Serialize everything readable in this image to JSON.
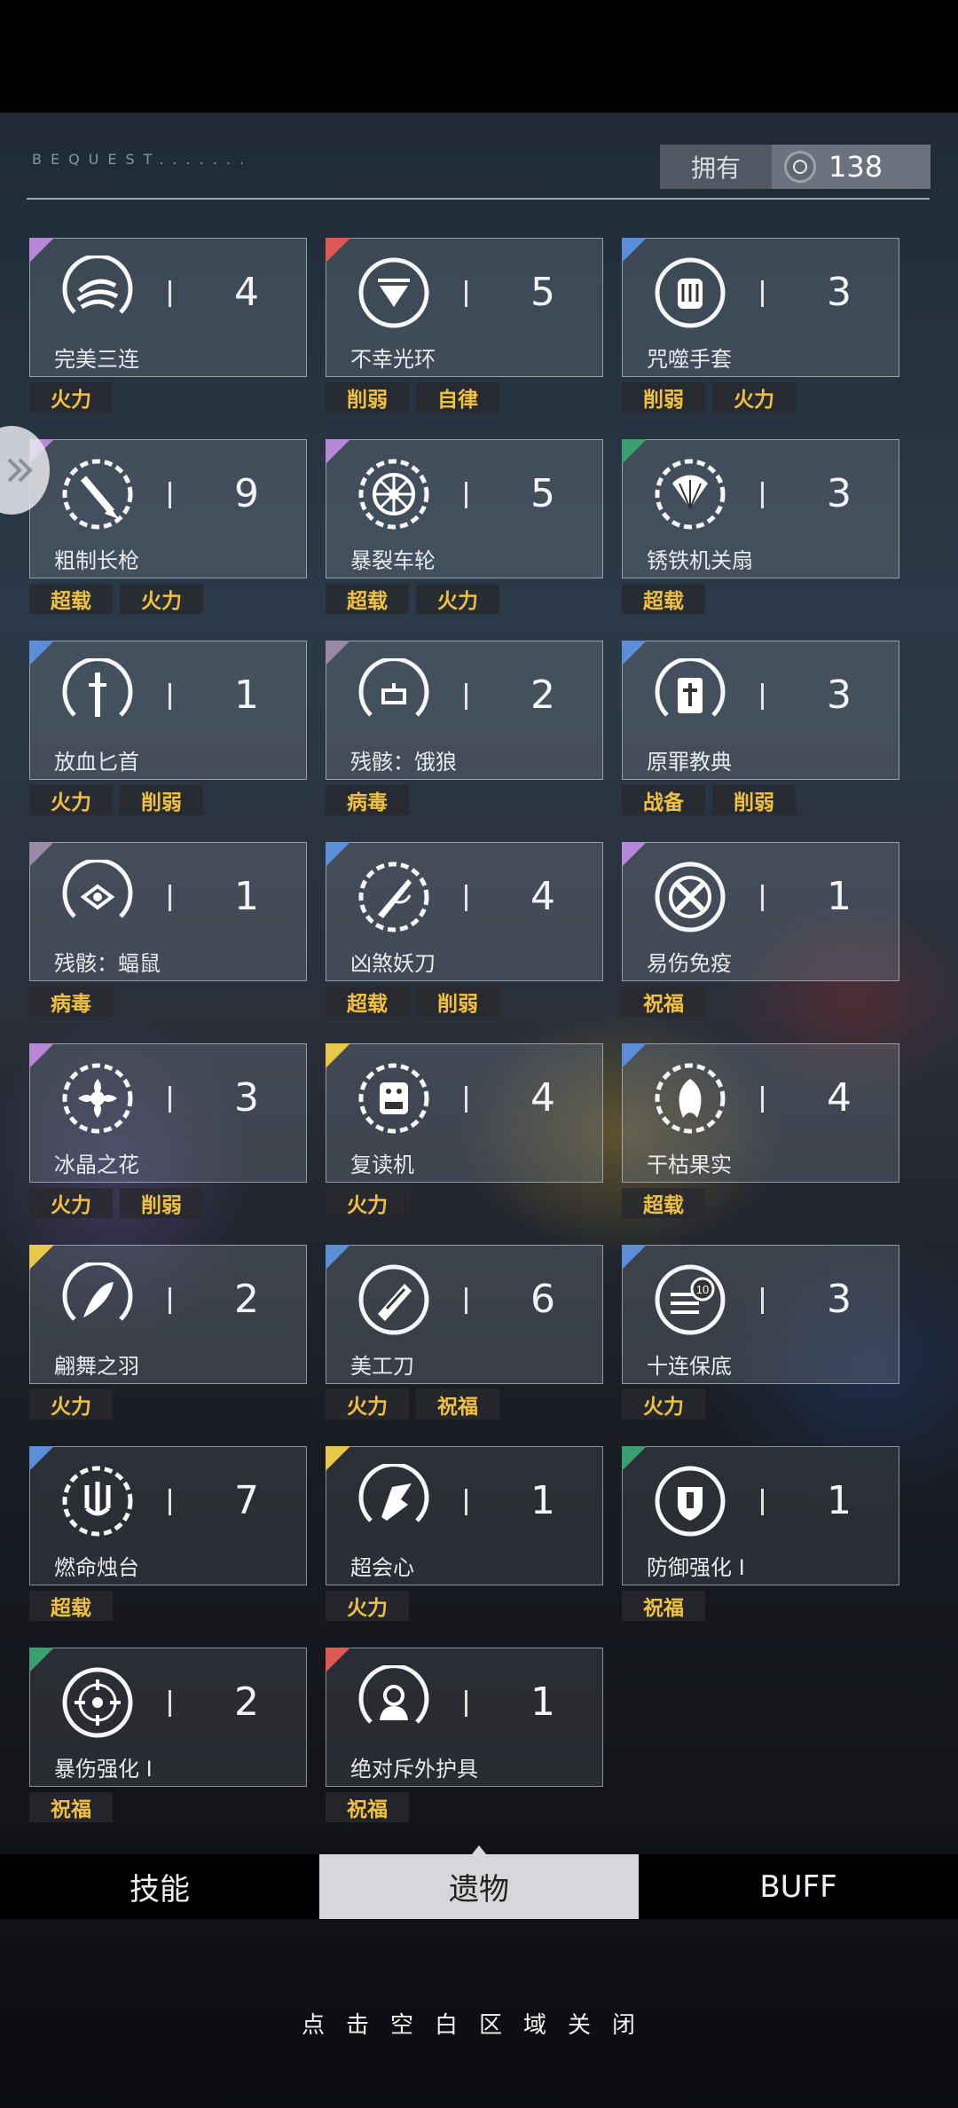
{
  "header": {
    "subtitle": "BEQUEST.......",
    "owned_label": "拥有",
    "owned_value": "138",
    "coin_icon": "coin-icon"
  },
  "relics": [
    {
      "name": "完美三连",
      "count": "4",
      "corner": "#b888d8",
      "icon": "triple-slash-icon",
      "tags": [
        "火力"
      ]
    },
    {
      "name": "不幸光环",
      "count": "5",
      "corner": "#e05a55",
      "icon": "down-halo-icon",
      "tags": [
        "削弱",
        "自律"
      ]
    },
    {
      "name": "咒噬手套",
      "count": "3",
      "corner": "#5a8ed8",
      "icon": "cursed-glove-icon",
      "tags": [
        "削弱",
        "火力"
      ]
    },
    {
      "name": "粗制长枪",
      "count": "9",
      "corner": "#b888d8",
      "icon": "spear-icon",
      "tags": [
        "超载",
        "火力"
      ]
    },
    {
      "name": "暴裂车轮",
      "count": "5",
      "corner": "#b888d8",
      "icon": "wheel-icon",
      "tags": [
        "超载",
        "火力"
      ]
    },
    {
      "name": "锈铁机关扇",
      "count": "3",
      "corner": "#3aa070",
      "icon": "fan-icon",
      "tags": [
        "超载"
      ]
    },
    {
      "name": "放血匕首",
      "count": "1",
      "corner": "#5a8ed8",
      "icon": "dagger-icon",
      "tags": [
        "火力",
        "削弱"
      ]
    },
    {
      "name": "残骸：饿狼",
      "count": "2",
      "corner": "#9a8aa8",
      "icon": "wolf-remains-icon",
      "tags": [
        "病毒"
      ]
    },
    {
      "name": "原罪教典",
      "count": "3",
      "corner": "#5a8ed8",
      "icon": "scripture-icon",
      "tags": [
        "战备",
        "削弱"
      ]
    },
    {
      "name": "残骸：蝠鼠",
      "count": "1",
      "corner": "#9a8aa8",
      "icon": "bat-remains-icon",
      "tags": [
        "病毒"
      ]
    },
    {
      "name": "凶煞妖刀",
      "count": "4",
      "corner": "#5a8ed8",
      "icon": "demon-blade-icon",
      "tags": [
        "超载",
        "削弱"
      ]
    },
    {
      "name": "易伤免疫",
      "count": "1",
      "corner": "#b888d8",
      "icon": "immunity-icon",
      "tags": [
        "祝福"
      ]
    },
    {
      "name": "冰晶之花",
      "count": "3",
      "corner": "#b888d8",
      "icon": "ice-flower-icon",
      "tags": [
        "火力",
        "削弱"
      ]
    },
    {
      "name": "复读机",
      "count": "4",
      "corner": "#e8c84a",
      "icon": "repeater-icon",
      "tags": [
        "火力"
      ]
    },
    {
      "name": "干枯果实",
      "count": "4",
      "corner": "#5a8ed8",
      "icon": "withered-fruit-icon",
      "tags": [
        "超载"
      ]
    },
    {
      "name": "翩舞之羽",
      "count": "2",
      "corner": "#e8c84a",
      "icon": "feather-icon",
      "tags": [
        "火力"
      ]
    },
    {
      "name": "美工刀",
      "count": "6",
      "corner": "#5a8ed8",
      "icon": "utility-knife-icon",
      "tags": [
        "火力",
        "祝福"
      ]
    },
    {
      "name": "十连保底",
      "count": "3",
      "corner": "#5a8ed8",
      "icon": "ten-pull-icon",
      "tags": [
        "火力"
      ]
    },
    {
      "name": "燃命烛台",
      "count": "7",
      "corner": "#5a8ed8",
      "icon": "candelabra-icon",
      "tags": [
        "超载"
      ]
    },
    {
      "name": "超会心",
      "count": "1",
      "corner": "#e8c84a",
      "icon": "critical-icon",
      "tags": [
        "火力"
      ]
    },
    {
      "name": "防御强化 I",
      "count": "1",
      "corner": "#3aa070",
      "icon": "shield-icon",
      "tags": [
        "祝福"
      ]
    },
    {
      "name": "暴伤强化 I",
      "count": "2",
      "corner": "#3aa070",
      "icon": "crosshair-icon",
      "tags": [
        "祝福"
      ]
    },
    {
      "name": "绝对斥外护具",
      "count": "1",
      "corner": "#e05a55",
      "icon": "protective-gear-icon",
      "tags": [
        "祝福"
      ]
    }
  ],
  "tabs": [
    {
      "label": "技能",
      "active": false
    },
    {
      "label": "遗物",
      "active": true
    },
    {
      "label": "BUFF",
      "active": false
    }
  ],
  "footer": {
    "close_hint": "点击空白区域关闭"
  }
}
